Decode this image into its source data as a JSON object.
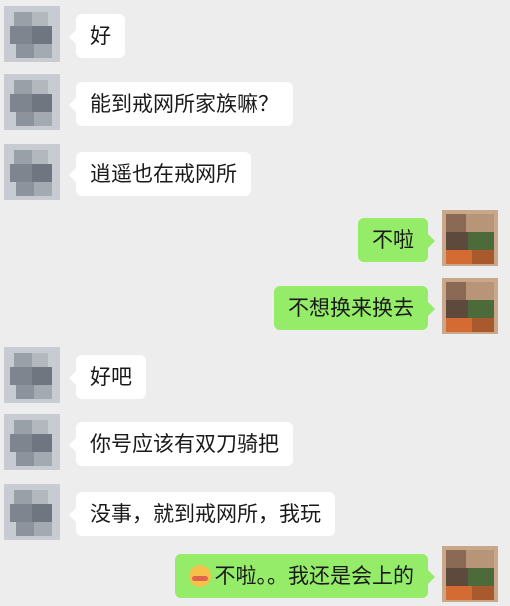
{
  "messages": [
    {
      "side": "left",
      "text": "好"
    },
    {
      "side": "left",
      "text": "能到戒网所家族嘛？"
    },
    {
      "side": "left",
      "text": "逍遥也在戒网所"
    },
    {
      "side": "right",
      "text": "不啦"
    },
    {
      "side": "right",
      "text": "不想换来换去"
    },
    {
      "side": "left",
      "text": "好吧"
    },
    {
      "side": "left",
      "text": "你号应该有双刀骑把"
    },
    {
      "side": "left",
      "text": "没事，就到戒网所，我玩"
    },
    {
      "side": "right",
      "text": "不啦。。我还是会上的",
      "emoji": "smiling-face-emoji"
    }
  ],
  "colors": {
    "background": "#ededed",
    "incoming_bubble": "#ffffff",
    "outgoing_bubble": "#95ec69"
  }
}
